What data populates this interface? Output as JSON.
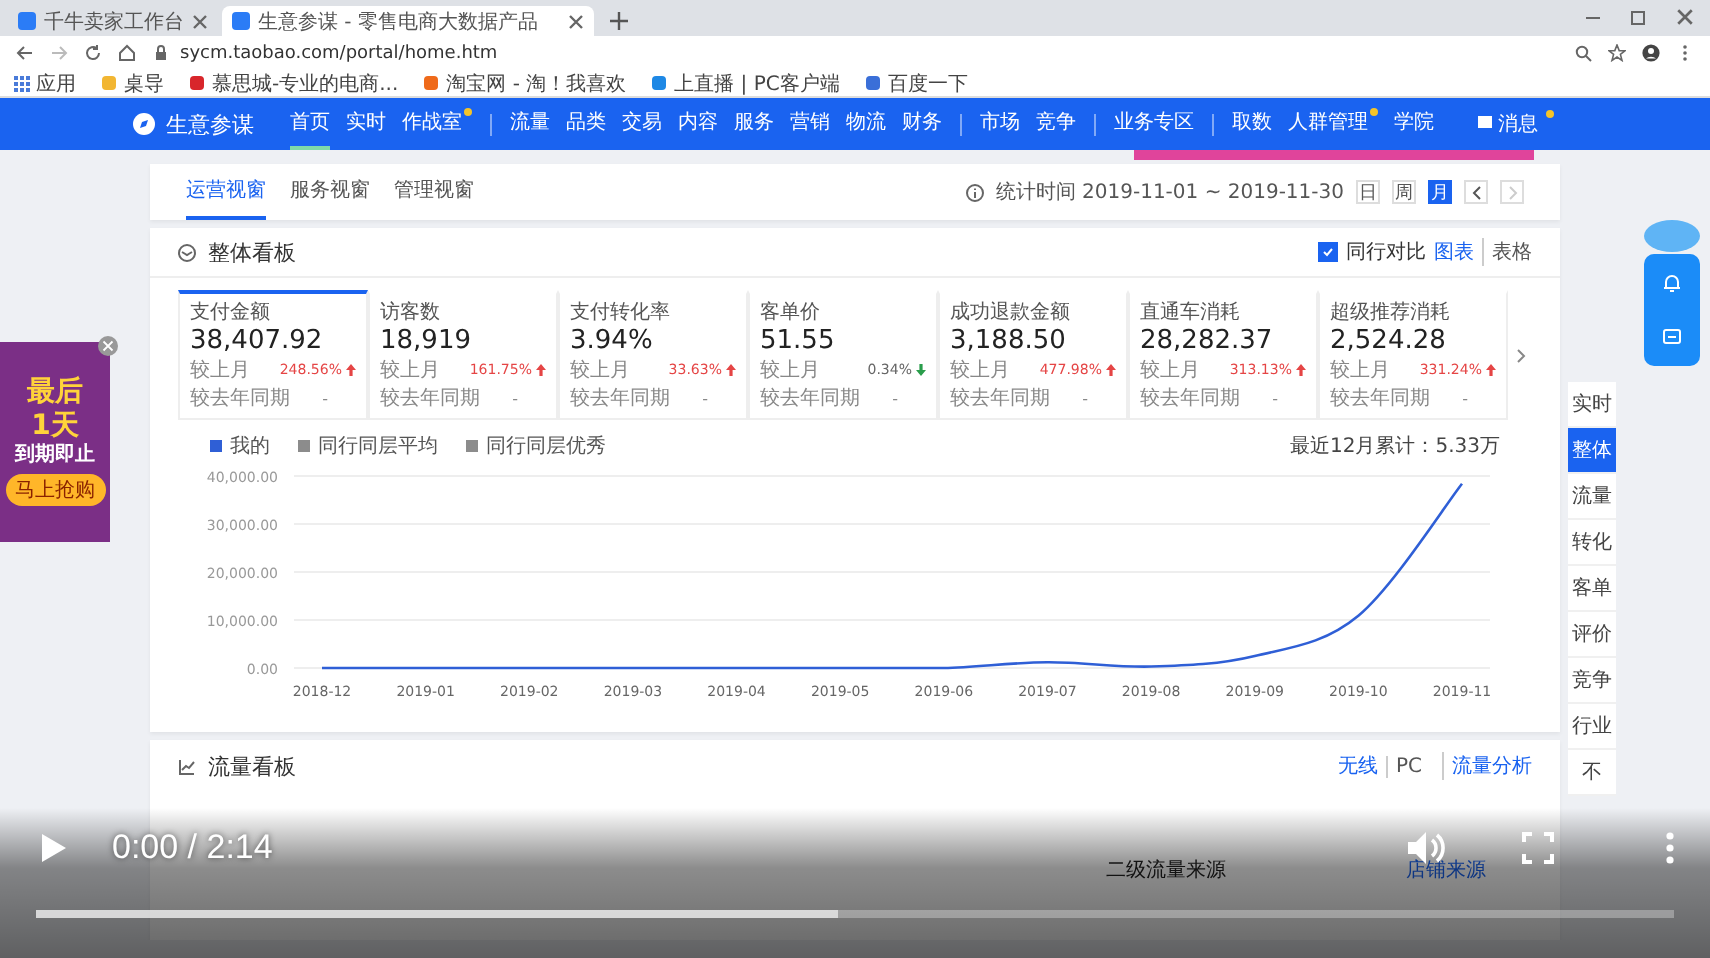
{
  "browser": {
    "tabs": [
      {
        "title": "千牛卖家工作台",
        "selected": false
      },
      {
        "title": "生意参谋 - 零售电商大数据产品",
        "selected": true
      }
    ],
    "url": "sycm.taobao.com/portal/home.htm",
    "bookmarks": [
      "应用",
      "桌导",
      "慕思城-专业的电商...",
      "淘宝网 - 淘！我喜欢",
      "上直播 | PC客户端",
      "百度一下"
    ]
  },
  "nav": {
    "logo": "生意参谋",
    "groups": [
      [
        {
          "label": "首页",
          "selected": true,
          "badge": false
        },
        {
          "label": "实时",
          "selected": false,
          "badge": false
        },
        {
          "label": "作战室",
          "selected": false,
          "badge": true
        }
      ],
      [
        {
          "label": "流量",
          "selected": false,
          "badge": false
        },
        {
          "label": "品类",
          "selected": false,
          "badge": false
        },
        {
          "label": "交易",
          "selected": false,
          "badge": false
        },
        {
          "label": "内容",
          "selected": false,
          "badge": false
        },
        {
          "label": "服务",
          "selected": false,
          "badge": false
        },
        {
          "label": "营销",
          "selected": false,
          "badge": false
        },
        {
          "label": "物流",
          "selected": false,
          "badge": false
        },
        {
          "label": "财务",
          "selected": false,
          "badge": false
        }
      ],
      [
        {
          "label": "市场",
          "selected": false,
          "badge": false
        },
        {
          "label": "竞争",
          "selected": false,
          "badge": false
        }
      ],
      [
        {
          "label": "业务专区",
          "selected": false,
          "badge": false
        }
      ],
      [
        {
          "label": "取数",
          "selected": false,
          "badge": false
        },
        {
          "label": "人群管理",
          "selected": false,
          "badge": true
        },
        {
          "label": "学院",
          "selected": false,
          "badge": false
        }
      ]
    ],
    "message": {
      "label": "消息",
      "badge": true
    }
  },
  "subtabs": [
    {
      "label": "运营视窗",
      "selected": true
    },
    {
      "label": "服务视窗",
      "selected": false
    },
    {
      "label": "管理视窗",
      "selected": false
    }
  ],
  "date_range": {
    "label": "统计时间 2019-11-01 ~ 2019-11-30",
    "periods": [
      {
        "label": "日",
        "selected": false
      },
      {
        "label": "周",
        "selected": false
      },
      {
        "label": "月",
        "selected": true
      }
    ]
  },
  "overview": {
    "title": "整体看板",
    "compare": {
      "label": "同行对比",
      "checked": true
    },
    "views": [
      {
        "label": "图表",
        "selected": true
      },
      {
        "label": "表格",
        "selected": false
      }
    ],
    "metrics": [
      {
        "label": "支付金额",
        "value": "38,407.92",
        "selected": true,
        "mom_label": "较上月",
        "mom": "248.56%",
        "rising": true,
        "yoy_label": "较去年同期",
        "yoy": "-"
      },
      {
        "label": "访客数",
        "value": "18,919",
        "selected": false,
        "mom_label": "较上月",
        "mom": "161.75%",
        "rising": true,
        "yoy_label": "较去年同期",
        "yoy": "-"
      },
      {
        "label": "支付转化率",
        "value": "3.94%",
        "selected": false,
        "mom_label": "较上月",
        "mom": "33.63%",
        "rising": true,
        "yoy_label": "较去年同期",
        "yoy": "-"
      },
      {
        "label": "客单价",
        "value": "51.55",
        "selected": false,
        "mom_label": "较上月",
        "mom": "0.34%",
        "rising": false,
        "yoy_label": "较去年同期",
        "yoy": "-"
      },
      {
        "label": "成功退款金额",
        "value": "3,188.50",
        "selected": false,
        "mom_label": "较上月",
        "mom": "477.98%",
        "rising": true,
        "yoy_label": "较去年同期",
        "yoy": "-"
      },
      {
        "label": "直通车消耗",
        "value": "28,282.37",
        "selected": false,
        "mom_label": "较上月",
        "mom": "313.13%",
        "rising": true,
        "yoy_label": "较去年同期",
        "yoy": "-"
      },
      {
        "label": "超级推荐消耗",
        "value": "2,524.28",
        "selected": false,
        "mom_label": "较上月",
        "mom": "331.24%",
        "rising": true,
        "yoy_label": "较去年同期",
        "yoy": "-"
      }
    ],
    "peer_legend": [
      {
        "label": "同行同层平均",
        "color": "#8c8c8c"
      },
      {
        "label": "同行同层优秀",
        "color": "#8c8c8c"
      }
    ],
    "total": "最近12月累计：5.33万",
    "chart_data": {
      "type": "line",
      "categories": [
        "2018-12",
        "2019-01",
        "2019-02",
        "2019-03",
        "2019-04",
        "2019-05",
        "2019-06",
        "2019-07",
        "2019-08",
        "2019-09",
        "2019-10",
        "2019-11"
      ],
      "series": [
        {
          "name": "我的",
          "color": "#2f5fd6",
          "values": [
            0,
            0,
            0,
            0,
            0,
            0,
            0,
            1200,
            300,
            2500,
            10900,
            38400
          ]
        }
      ],
      "ylim": [
        0,
        40000
      ],
      "grid": true,
      "yticks": [
        {
          "value": 0,
          "label": "0.00"
        },
        {
          "value": 10000,
          "label": "10,000.00"
        },
        {
          "value": 20000,
          "label": "20,000.00"
        },
        {
          "value": 30000,
          "label": "30,000.00"
        },
        {
          "value": 40000,
          "label": "40,000.00"
        }
      ]
    }
  },
  "side_nav": [
    {
      "label": "实时",
      "selected": false
    },
    {
      "label": "整体",
      "selected": true
    },
    {
      "label": "流量",
      "selected": false
    },
    {
      "label": "转化",
      "selected": false
    },
    {
      "label": "客单",
      "selected": false
    },
    {
      "label": "评价",
      "selected": false
    },
    {
      "label": "竞争",
      "selected": false
    },
    {
      "label": "行业",
      "selected": false
    },
    {
      "label": "不",
      "selected": false
    }
  ],
  "ad": {
    "lines": [
      "最后",
      "1天",
      "到期即止"
    ],
    "button": "马上抢购"
  },
  "traffic": {
    "title": "流量看板",
    "links": [
      "无线",
      "PC"
    ],
    "analysis": "流量分析",
    "source_title": "二级流量来源",
    "source_link": "店铺来源"
  },
  "video": {
    "time": "0:00 / 2:14",
    "level": 0.49
  }
}
